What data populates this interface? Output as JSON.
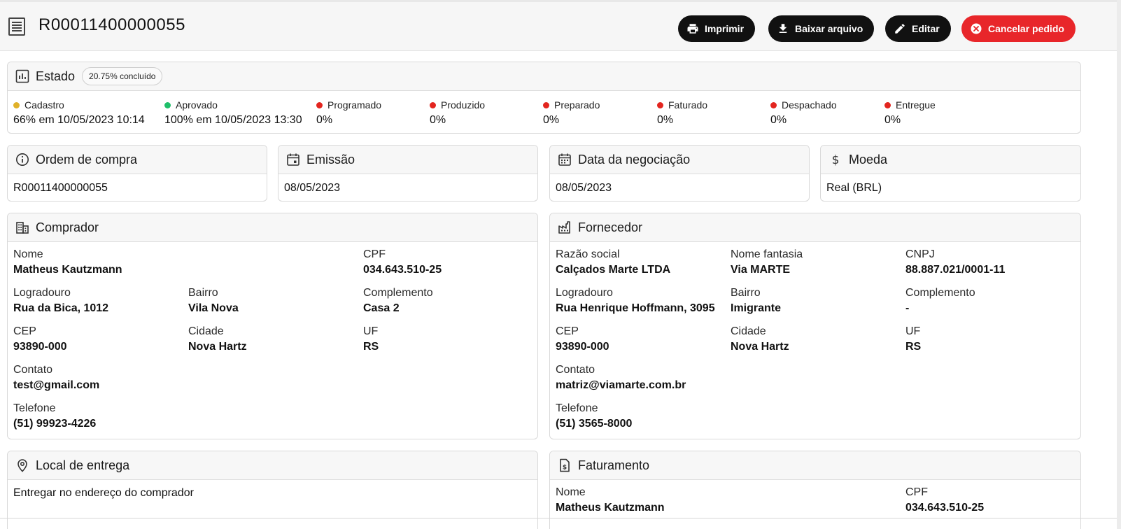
{
  "header": {
    "title": "R00011400000055",
    "buttons": {
      "print": "Imprimir",
      "download": "Baixar arquivo",
      "edit": "Editar",
      "cancel": "Cancelar pedido"
    }
  },
  "status": {
    "title": "Estado",
    "badge": "20.75% concluído",
    "stages": [
      {
        "label": "Cadastro",
        "value": "66% em 10/05/2023 10:14",
        "color": "#e0b12a"
      },
      {
        "label": "Aprovado",
        "value": "100% em 10/05/2023 13:30",
        "color": "#1fbf6a"
      },
      {
        "label": "Programado",
        "value": "0%",
        "color": "#e3251f"
      },
      {
        "label": "Produzido",
        "value": "0%",
        "color": "#e3251f"
      },
      {
        "label": "Preparado",
        "value": "0%",
        "color": "#e3251f"
      },
      {
        "label": "Faturado",
        "value": "0%",
        "color": "#e3251f"
      },
      {
        "label": "Despachado",
        "value": "0%",
        "color": "#e3251f"
      },
      {
        "label": "Entregue",
        "value": "0%",
        "color": "#e3251f"
      }
    ]
  },
  "order": {
    "title": "Ordem de compra",
    "value": "R00011400000055"
  },
  "issue": {
    "title": "Emissão",
    "value": "08/05/2023"
  },
  "negotiation": {
    "title": "Data da negociação",
    "value": "08/05/2023"
  },
  "currency": {
    "title": "Moeda",
    "value": "Real (BRL)"
  },
  "buyer": {
    "title": "Comprador",
    "nome_label": "Nome",
    "nome": "Matheus Kautzmann",
    "cpf_label": "CPF",
    "cpf": "034.643.510-25",
    "logradouro_label": "Logradouro",
    "logradouro": "Rua da Bica, 1012",
    "bairro_label": "Bairro",
    "bairro": "Vila Nova",
    "complemento_label": "Complemento",
    "complemento": "Casa 2",
    "cep_label": "CEP",
    "cep": "93890-000",
    "cidade_label": "Cidade",
    "cidade": "Nova Hartz",
    "uf_label": "UF",
    "uf": "RS",
    "contato_label": "Contato",
    "contato": "test@gmail.com",
    "telefone_label": "Telefone",
    "telefone": "(51) 99923-4226"
  },
  "supplier": {
    "title": "Fornecedor",
    "razao_label": "Razão social",
    "razao": "Calçados Marte LTDA",
    "fantasia_label": "Nome fantasia",
    "fantasia": "Via MARTE",
    "cnpj_label": "CNPJ",
    "cnpj": "88.887.021/0001-11",
    "logradouro_label": "Logradouro",
    "logradouro": "Rua Henrique Hoffmann, 3095",
    "bairro_label": "Bairro",
    "bairro": "Imigrante",
    "complemento_label": "Complemento",
    "complemento": "-",
    "cep_label": "CEP",
    "cep": "93890-000",
    "cidade_label": "Cidade",
    "cidade": "Nova Hartz",
    "uf_label": "UF",
    "uf": "RS",
    "contato_label": "Contato",
    "contato": "matriz@viamarte.com.br",
    "telefone_label": "Telefone",
    "telefone": "(51) 3565-8000"
  },
  "delivery": {
    "title": "Local de entrega",
    "value": "Entregar no endereço do comprador"
  },
  "billing": {
    "title": "Faturamento",
    "nome_label": "Nome",
    "nome": "Matheus Kautzmann",
    "cpf_label": "CPF",
    "cpf": "034.643.510-25"
  }
}
